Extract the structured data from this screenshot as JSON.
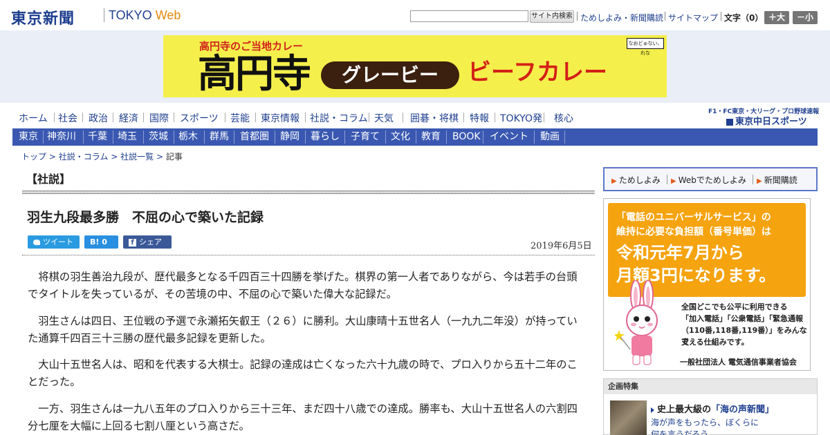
{
  "header": {
    "logo_kanji": "東京新聞",
    "logo_tokyo": "TOKYO",
    "logo_web": "Web",
    "search_button": "サイト内検索",
    "links": [
      "ためしよみ・新聞購読",
      "サイトマップ"
    ],
    "font_size_label": "文字（0）",
    "font_bigger": "＋大",
    "font_smaller": "－小"
  },
  "banner": {
    "sub": "高円寺のご当地カレー",
    "big": "高円寺",
    "gravy": "グレービー",
    "curry": "ビーフカレー",
    "logo": "なおどゅない、れな"
  },
  "nav_primary": [
    "ホーム",
    "社会",
    "政治",
    "経済",
    "国際",
    "スポーツ",
    "芸能",
    "東京情報",
    "社説・コラム",
    "天気",
    "囲碁・将棋",
    "特報",
    "TOKYO発",
    "核心"
  ],
  "chunichi": {
    "top": "F1・FC東京・大リーグ・プロ野球速報",
    "name": "東京中日スポーツ"
  },
  "nav_regional": [
    "東京",
    "神奈川",
    "千葉",
    "埼玉",
    "茨城",
    "栃木",
    "群馬",
    "首都圏",
    "静岡",
    "暮らし",
    "子育て",
    "文化",
    "教育",
    "BOOK",
    "イベント",
    "動画"
  ],
  "breadcrumb": {
    "items": [
      "トップ",
      "社説・コラム",
      "社説一覧"
    ],
    "sep": ">",
    "current": "記事"
  },
  "article": {
    "section": "【社説】",
    "headline": "羽生九段最多勝　不屈の心で築いた記録",
    "share_tweet": "ツイート",
    "share_hatena": "B!  0",
    "share_facebook": "シェア 0",
    "date": "2019年6月5日",
    "paragraphs": [
      "将棋の羽生善治九段が、歴代最多となる千四百三十四勝を挙げた。棋界の第一人者でありながら、今は若手の台頭でタイトルを失っているが、その苦境の中、不屈の心で築いた偉大な記録だ。",
      "羽生さんは四日、王位戦の予選で永瀬拓矢叡王（２６）に勝利。大山康晴十五世名人（一九九二年没）が持っていた通算千四百三十三勝の歴代最多記録を更新した。",
      "大山十五世名人は、昭和を代表する大棋士。記録の達成は亡くなった六十九歳の時で、プロ入りから五十二年のことだった。",
      "一方、羽生さんは一九八五年のプロ入りから三十三年、まだ四十八歳での達成。勝率も、大山十五世名人の六割四分七厘を大幅に上回る七割八厘という高さだ。"
    ]
  },
  "sidebar": {
    "trial_links": [
      "ためしよみ",
      "Webでためしよみ",
      "新聞購読"
    ],
    "ad": {
      "line1": "「電話のユニバーサルサービス」の",
      "line2": "維持に必要な負担額（番号単価）は",
      "line3": "令和元年7月から",
      "line4": "月額3円になります。",
      "body": [
        "全国どこでも公平に利用できる",
        "「加入電話」「公衆電話」「緊急通報",
        "（110番,118番,119番）」をみんなで",
        "支える仕組みです。"
      ],
      "org": "一般社団法人 電気通信事業者協会"
    },
    "feature": {
      "heading": "企画特集",
      "title_prefix": "史上最大級の",
      "title_link": "「海の声新聞」",
      "desc": "海が声をもったら、ぼくらに何を言うだろう"
    }
  }
}
